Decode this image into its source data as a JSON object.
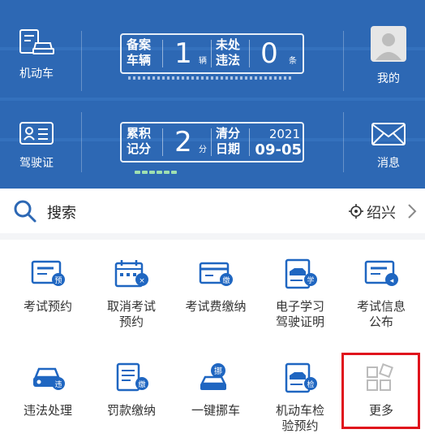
{
  "colors": {
    "hero_bg": "#2d68b4",
    "icon_blue": "#1f66c1",
    "highlight": "#e0121c",
    "progress": "#9fe0b0"
  },
  "header": {
    "vehicle_label": "机动车",
    "license_label": "驾驶证",
    "profile_label": "我的",
    "message_label": "消息"
  },
  "vehicle_card": {
    "registered_label_1": "备案",
    "registered_label_2": "车辆",
    "registered_count": "1",
    "registered_unit": "辆",
    "violations_label_1": "未处",
    "violations_label_2": "违法",
    "violations_count": "0",
    "violations_unit": "条"
  },
  "license_card": {
    "points_label_1": "累积",
    "points_label_2": "记分",
    "points_value": "2",
    "points_unit": "分",
    "clear_label_1": "清分",
    "clear_label_2": "日期",
    "clear_year": "2021",
    "clear_date": "09-05",
    "progress_fraction": 0.25
  },
  "search": {
    "placeholder": "搜索",
    "city": "绍兴"
  },
  "services": [
    {
      "label": "考试预约",
      "label2": "",
      "icon": "exam-booking-icon",
      "badge": "预"
    },
    {
      "label": "取消考试",
      "label2": "预约",
      "icon": "cancel-exam-icon",
      "badge": "×"
    },
    {
      "label": "考试费缴纳",
      "label2": "",
      "icon": "exam-fee-icon",
      "badge": "缴"
    },
    {
      "label": "电子学习",
      "label2": "驾驶证明",
      "icon": "learning-certificate-icon",
      "badge": "学"
    },
    {
      "label": "考试信息",
      "label2": "公布",
      "icon": "exam-info-icon",
      "badge": "◂"
    },
    {
      "label": "违法处理",
      "label2": "",
      "icon": "violation-car-icon",
      "badge": "违"
    },
    {
      "label": "罚款缴纳",
      "label2": "",
      "icon": "fine-payment-icon",
      "badge": "缴"
    },
    {
      "label": "一键挪车",
      "label2": "",
      "icon": "move-car-icon",
      "badge": "挪"
    },
    {
      "label": "机动车检",
      "label2": "验预约",
      "icon": "inspection-booking-icon",
      "badge": "检"
    },
    {
      "label": "更多",
      "label2": "",
      "icon": "more-apps-icon",
      "badge": ""
    }
  ]
}
